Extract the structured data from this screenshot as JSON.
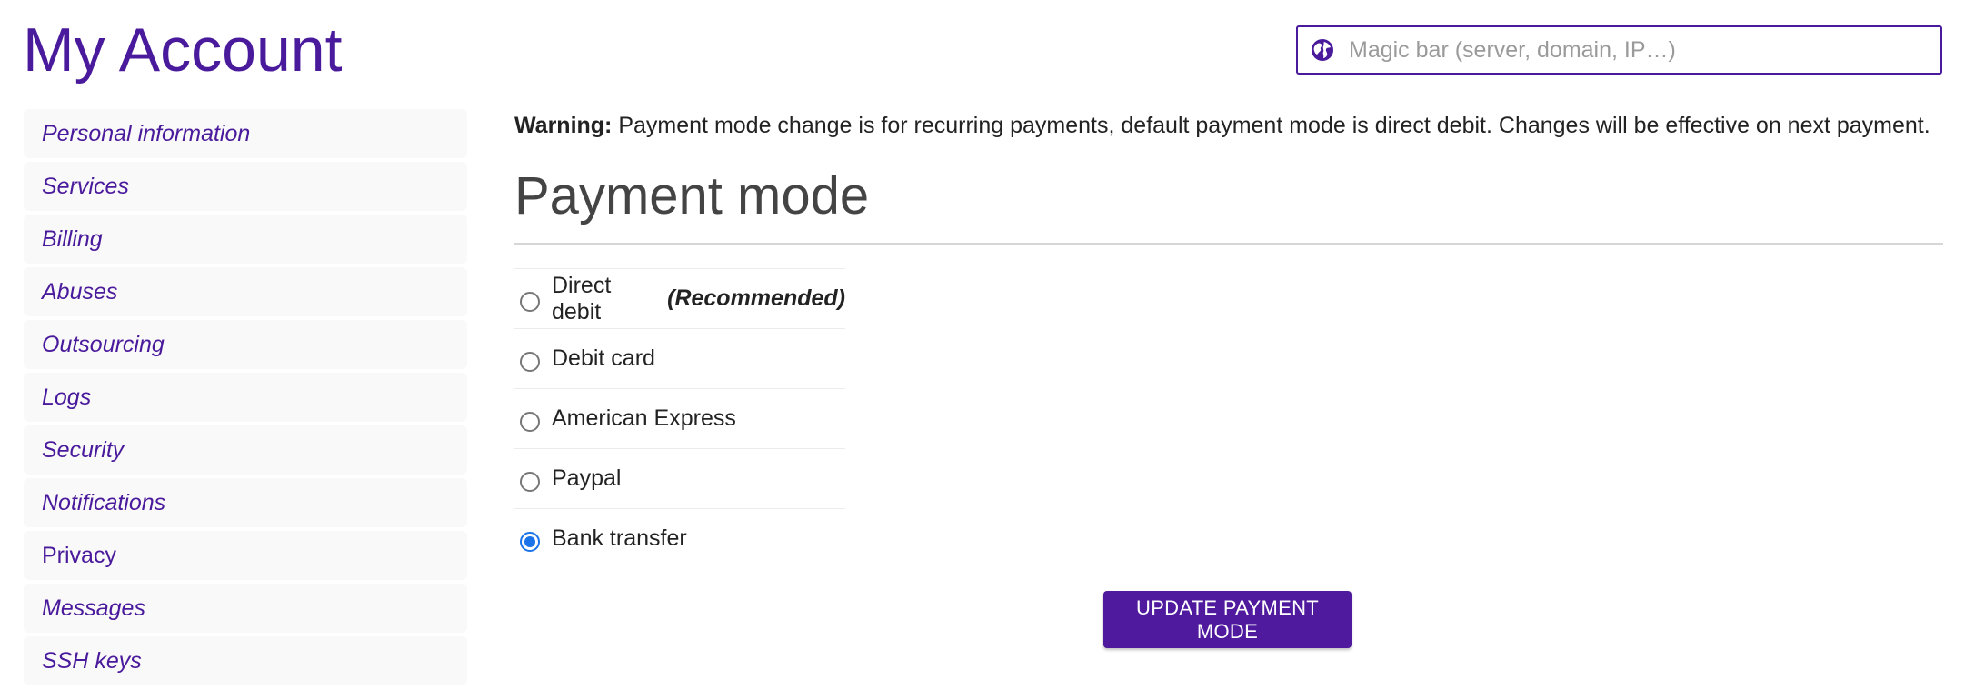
{
  "header": {
    "title": "My Account"
  },
  "magic_bar": {
    "placeholder": "Magic bar (server, domain, IP…)",
    "icon": "globe-icon"
  },
  "sidebar": {
    "items": [
      {
        "label": "Personal information"
      },
      {
        "label": "Services"
      },
      {
        "label": "Billing"
      },
      {
        "label": "Abuses"
      },
      {
        "label": "Outsourcing"
      },
      {
        "label": "Logs"
      },
      {
        "label": "Security"
      },
      {
        "label": "Notifications"
      },
      {
        "label": "Privacy"
      },
      {
        "label": "Messages"
      },
      {
        "label": "SSH keys"
      }
    ]
  },
  "main": {
    "warning_label": "Warning:",
    "warning_text": "Payment mode change is for recurring payments, default payment mode is direct debit. Changes will be effective on next payment.",
    "section_title": "Payment mode",
    "options": [
      {
        "label": "Direct debit",
        "note": "(Recommended)",
        "checked": false
      },
      {
        "label": "Debit card",
        "checked": false
      },
      {
        "label": "American Express",
        "checked": false
      },
      {
        "label": "Paypal",
        "checked": false
      },
      {
        "label": "Bank transfer",
        "checked": true
      }
    ],
    "update_button": "UPDATE PAYMENT MODE"
  },
  "colors": {
    "brand": "#4a1a9c",
    "radio_checked": "#1a73e8"
  }
}
